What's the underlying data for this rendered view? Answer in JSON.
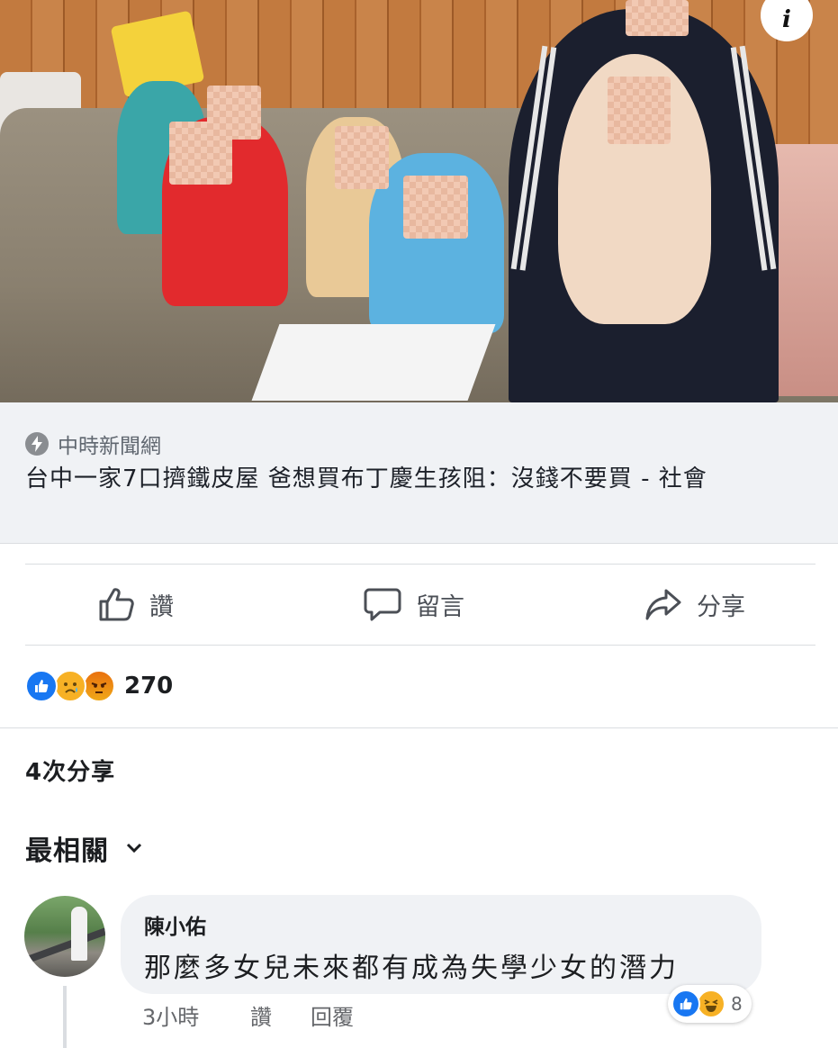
{
  "post": {
    "link": {
      "source": "中時新聞網",
      "title": "台中一家7口擠鐵皮屋 爸想買布丁慶生孩阻：沒錢不要買 - 社會"
    },
    "actions": {
      "like": "讚",
      "comment": "留言",
      "share": "分享"
    },
    "reactions": {
      "types": [
        "like",
        "sad",
        "angry"
      ],
      "count": "270"
    },
    "shares_text": "4次分享",
    "sort_label": "最相關"
  },
  "comment": {
    "author": "陳小佑",
    "text": "那麼多女兒未來都有成為失學少女的潛力",
    "time": "3小時",
    "like": "讚",
    "reply": "回覆",
    "reaction_types": [
      "like",
      "haha"
    ],
    "reaction_count": "8"
  },
  "colors": {
    "facebook_blue": "#1877f2",
    "link_box_bg": "#f0f2f5",
    "muted_text": "#65676b"
  }
}
